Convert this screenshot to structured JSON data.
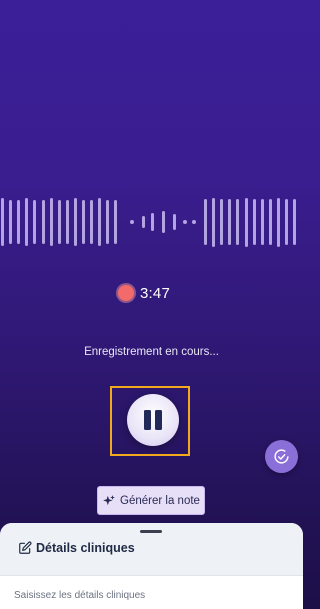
{
  "recording": {
    "timer": "3:47",
    "status_text": "Enregistrement en cours..."
  },
  "controls": {
    "pause_icon": "pause-icon",
    "fab_icon": "check-circle-icon",
    "generate_label": "Générer la note",
    "generate_icon": "sparkles-icon"
  },
  "sheet": {
    "title": "Détails cliniques",
    "title_icon": "edit-icon",
    "placeholder": "Saisissez les détails cliniques"
  },
  "colors": {
    "background_top": "#3a1f99",
    "background_bottom": "#1d0f48",
    "record_dot": "#f26a6a",
    "highlight_frame": "#f2a91e",
    "fab": "#8b6fd9",
    "generate_button": "#e7def8"
  }
}
